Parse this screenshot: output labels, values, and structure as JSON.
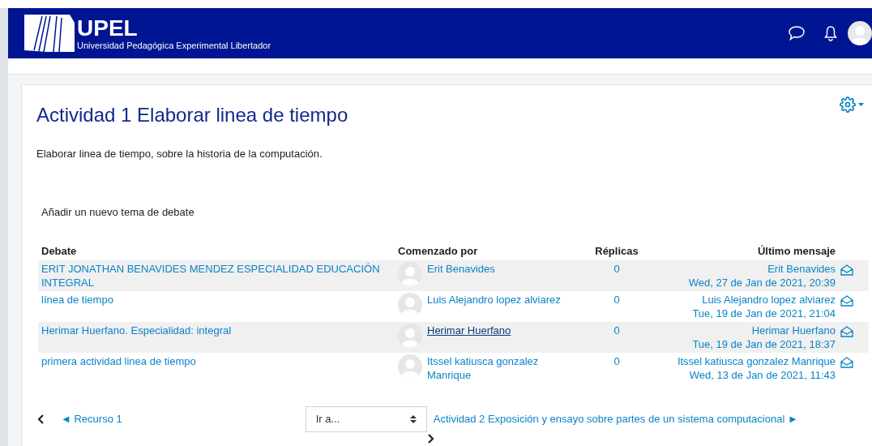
{
  "header": {
    "logo_text": "UPEL",
    "logo_subtitle": "Universidad Pedagógica Experimental Libertador"
  },
  "activity": {
    "title": "Actividad 1 Elaborar linea de tiempo",
    "description": "Elaborar linea de tiempo, sobre la historia de la computación.",
    "add_topic": "Añadir un nuevo tema de debate"
  },
  "table": {
    "columns": [
      "Debate",
      "Comenzado por",
      "Réplicas",
      "Último mensaje"
    ],
    "rows": [
      {
        "topic": "ERIT JONATHAN BENAVIDES MENDEZ ESPECIALIDAD EDUCACIÓN INTEGRAL",
        "started_by": "Erit Benavides",
        "hovered": false,
        "replies": "0",
        "last_author": "Erit Benavides",
        "last_date": "Wed, 27 de Jan de 2021, 20:39"
      },
      {
        "topic": "línea de tiempo",
        "started_by": "Luis Alejandro lopez alviarez",
        "hovered": false,
        "replies": "0",
        "last_author": "Luis Alejandro lopez alviarez",
        "last_date": "Tue, 19 de Jan de 2021, 21:04"
      },
      {
        "topic": "Herimar Huerfano. Especialidad: integral",
        "started_by": "Herimar Huerfano",
        "hovered": true,
        "replies": "0",
        "last_author": "Herimar Huerfano",
        "last_date": "Tue, 19 de Jan de 2021, 18:37"
      },
      {
        "topic": "primera actividad linea de tiempo",
        "started_by": "Itssel katiusca gonzalez Manrique",
        "hovered": false,
        "replies": "0",
        "last_author": "Itssel katiusca gonzalez Manrique",
        "last_date": "Wed, 13 de Jan de 2021, 11:43"
      }
    ]
  },
  "navigation": {
    "previous": "◄ Recurso 1",
    "jump_placeholder": "Ir a...",
    "next": "Actividad 2 Exposición y ensayo sobre partes de un sistema computacional ►"
  }
}
